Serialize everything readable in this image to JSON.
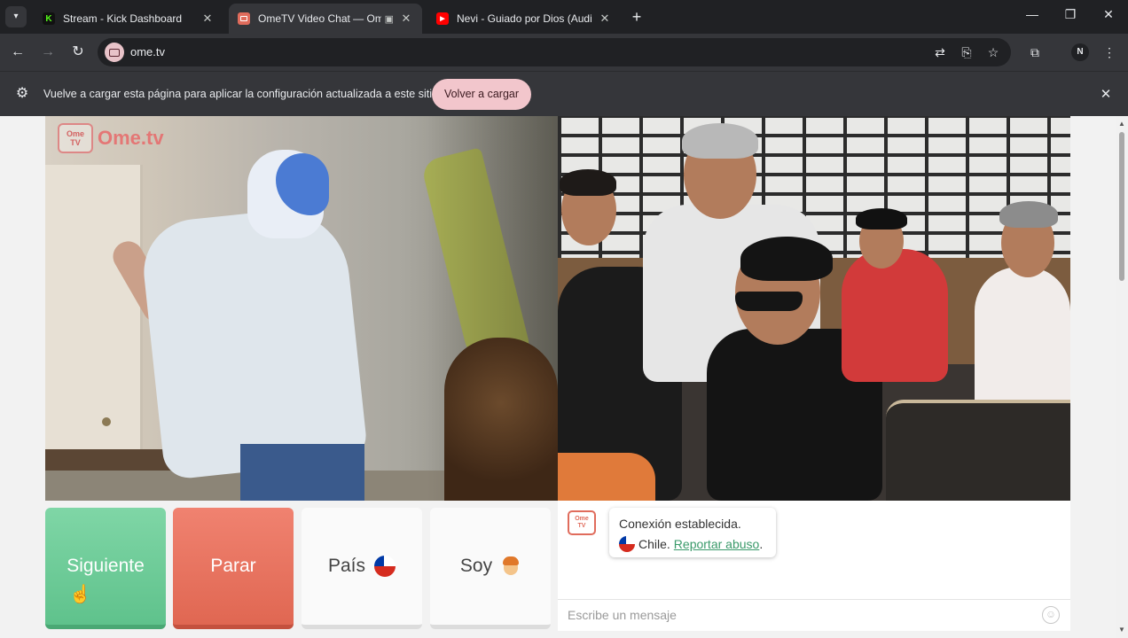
{
  "browser": {
    "tab_menu_icon": "chevron-down",
    "tabs": [
      {
        "title": "Stream - Kick Dashboard",
        "favicon": "K",
        "favicon_color": "#53fc18"
      },
      {
        "title": "OmeTV Video Chat — Ome",
        "favicon": "",
        "favicon_color": "#e06c5c"
      },
      {
        "title": "Nevi - Guiado por Dios (Audio",
        "favicon": "▶",
        "favicon_color": "#ff0000"
      }
    ],
    "new_tab_icon": "+",
    "url": "ome.tv",
    "avatar_initial": "N",
    "icons": [
      "back-arrow",
      "forward-arrow",
      "reload",
      "translate",
      "install-app",
      "bookmark-star",
      "extensions",
      "menu-dots"
    ]
  },
  "infobar": {
    "message": "Vuelve a cargar esta página para aplicar la configuración actualizada a este sitio",
    "button": "Volver a cargar"
  },
  "video": {
    "logo_small": "Ome\nTV",
    "logo_text": "Ome.tv"
  },
  "controls": {
    "next": "Siguiente",
    "stop": "Parar",
    "country": "País",
    "gender": "Soy"
  },
  "chat": {
    "logo": "Ome TV",
    "status": "Conexión establecida.",
    "country": "Chile.",
    "report_link": "Reportar abuso",
    "report_suffix": ".",
    "input_placeholder": "Escribe un mensaje"
  },
  "colors": {
    "next_button": "#6fcc98",
    "stop_button": "#e8735f",
    "report_link": "#3a9a6a",
    "reload_button": "#f2c6cc"
  }
}
